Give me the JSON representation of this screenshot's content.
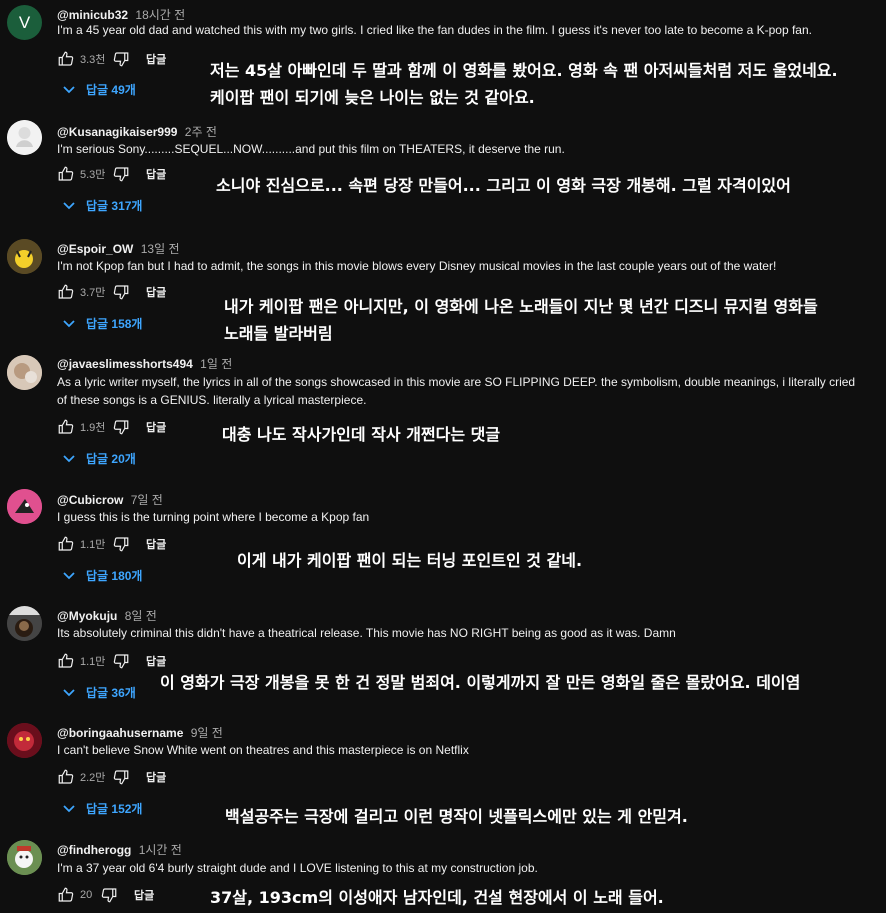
{
  "labels": {
    "reply": "답글"
  },
  "comments": [
    {
      "avatar_letter": "V",
      "avatar_color": "#1b5e3b",
      "user": "@minicub32",
      "time": "18시간 전",
      "text": "I'm a 45 year old dad and watched this with my two girls. I cried like the fan dudes in the film. I guess it's never too late to become a K-pop fan.",
      "likes": "3.3천",
      "replies": "답글 49개",
      "translation": [
        "저는 45살 아빠인데 두 딸과 함께 이 영화를 봤어요. 영화 속 팬 아저씨들처럼 저도 울었네요.",
        "케이팝 팬이 되기에 늦은 나이는 없는 것 같아요."
      ]
    },
    {
      "avatar_color": "#e8e8e8",
      "user": "@Kusanagikaiser999",
      "time": "2주 전",
      "text": "I'm serious Sony.........SEQUEL...NOW..........and put this film on THEATERS, it deserve the run.",
      "likes": "5.3만",
      "replies": "답글 317개",
      "translation": [
        "소니야 진심으로... 속편 당장 만들어... 그리고 이 영화 극장 개봉해. 그럴 자격이있어"
      ]
    },
    {
      "avatar_color": "#6b5a2a",
      "user": "@Espoir_OW",
      "time": "13일 전",
      "text": "I'm not Kpop fan but I had to admit, the songs in this movie blows every Disney musical movies in the last couple years out of the water!",
      "likes": "3.7만",
      "replies": "답글 158개",
      "translation": [
        "내가 케이팝 팬은 아니지만, 이 영화에 나온 노래들이 지난 몇 년간 디즈니 뮤지컬 영화들",
        "노래들 발라버림"
      ]
    },
    {
      "avatar_color": "#c9b8a8",
      "user": "@javaeslimesshorts494",
      "time": "1일 전",
      "text": "As a lyric writer myself, the lyrics in all of the songs showcased in this movie are SO FLIPPING DEEP. the symbolism, double meanings, i literally cried",
      "text2": "of these songs is a GENIUS. literally a lyrical masterpiece.",
      "likes": "1.9천",
      "replies": "답글 20개",
      "translation": [
        "대충 나도 작사가인데 작사 개쩐다는 댓글"
      ]
    },
    {
      "avatar_color": "#d94a8c",
      "user": "@Cubicrow",
      "time": "7일 전",
      "text": "I guess this is the turning point where I become a Kpop fan",
      "likes": "1.1만",
      "replies": "답글 180개",
      "translation": [
        "이게 내가 케이팝 팬이 되는 터닝 포인트인 것 같네."
      ]
    },
    {
      "avatar_color": "#3a3a3a",
      "user": "@Myokuju",
      "time": "8일 전",
      "text": "Its absolutely criminal this didn't have a theatrical release. This movie has NO RIGHT being as good as it was. Damn",
      "likes": "1.1만",
      "replies": "답글 36개",
      "translation": [
        "이 영화가 극장 개봉을 못 한 건 정말 범죄여. 이렇게까지 잘 만든 영화일 줄은 몰랐어요. 데이염"
      ]
    },
    {
      "avatar_color": "#8a1a2a",
      "user": "@boringaahusername",
      "time": "9일 전",
      "text": "I can't believe Snow White went on theatres and this masterpiece is on Netflix",
      "likes": "2.2만",
      "replies": "답글 152개",
      "translation": [
        "백설공주는 극장에 걸리고 이런 명작이 넷플릭스에만 있는 게 안믿겨."
      ]
    },
    {
      "avatar_color": "#7aa060",
      "user": "@findherogg",
      "time": "1시간 전",
      "text": "I'm a 37 year old 6'4 burly straight dude and I LOVE listening to this at my construction job.",
      "likes": "20",
      "replies": "",
      "translation": [
        "37살, 193cm의 이성애자 남자인데, 건설 현장에서 이 노래 들어."
      ]
    }
  ]
}
